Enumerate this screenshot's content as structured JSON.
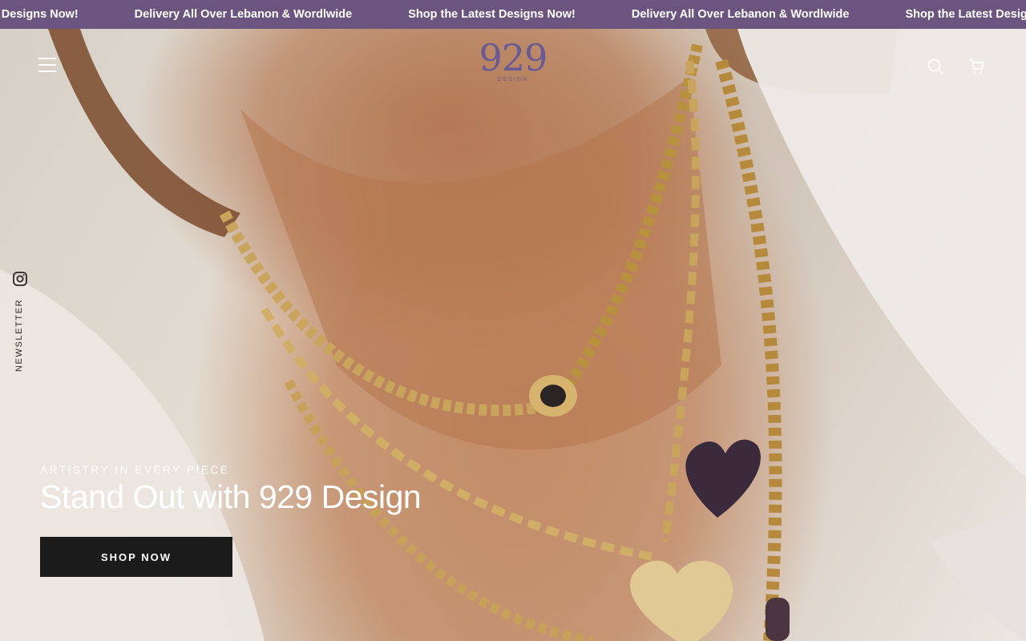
{
  "announcement": {
    "items": [
      "Shop the Latest Designs Now!",
      "Delivery All Over Lebanon & Wordlwide",
      "Shop the Latest Designs Now!",
      "Delivery All Over Lebanon & Wordlwide",
      "Shop the Latest Designs Now!"
    ],
    "background": "#6b547d"
  },
  "header": {
    "logo_digits": "929",
    "logo_sub": "DESIGN",
    "logo_color": "#6a5a93",
    "icons": [
      "menu-icon",
      "search-icon",
      "cart-icon"
    ]
  },
  "side_rail": {
    "social_icon": "instagram-icon",
    "newsletter_label": "NEWSLETTER"
  },
  "hero": {
    "kicker": "ARTISTRY IN EVERY PIECE",
    "headline": "Stand Out with 929 Design",
    "cta_label": "SHOP NOW"
  }
}
